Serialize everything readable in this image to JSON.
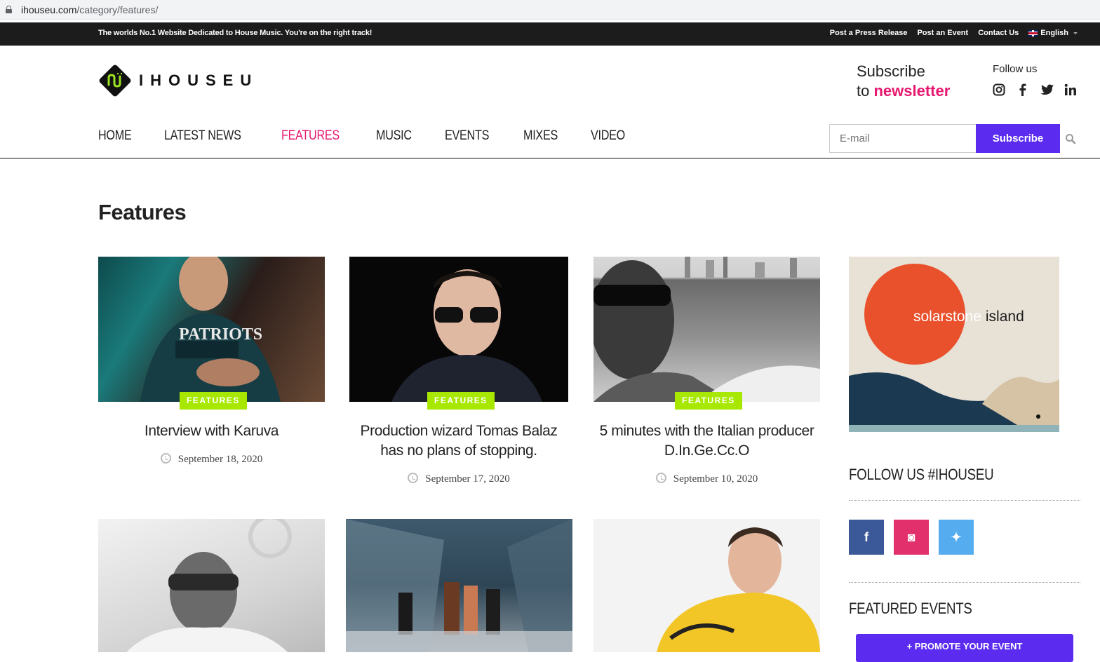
{
  "browser": {
    "url_domain": "ihouseu.com",
    "url_path": "/category/features/"
  },
  "topbar": {
    "tagline": "The worlds No.1 Website Dedicated to House Music. You're on the right track!",
    "links": [
      "Post a Press Release",
      "Post an Event",
      "Contact Us"
    ],
    "language": "English"
  },
  "header": {
    "logo_text": "IHOUSEU",
    "subscribe_line1": "Subscribe",
    "subscribe_line2_prefix": "to",
    "subscribe_line2_highlight": "newsletter",
    "follow_label": "Follow us",
    "social_icons": [
      "instagram-icon",
      "facebook-icon",
      "twitter-icon",
      "linkedin-icon"
    ]
  },
  "nav": {
    "items": [
      "HOME",
      "LATEST NEWS",
      "FEATURES",
      "MUSIC",
      "EVENTS",
      "MIXES",
      "VIDEO"
    ],
    "active": "FEATURES"
  },
  "newsletter": {
    "email_placeholder": "E-mail",
    "button_label": "Subscribe"
  },
  "page": {
    "title": "Features"
  },
  "articles": [
    {
      "category": "FEATURES",
      "title": "Interview with Karuva",
      "date": "September 18, 2020"
    },
    {
      "category": "FEATURES",
      "title": "Production wizard Tomas Balaz has no plans of stopping.",
      "date": "September 17, 2020"
    },
    {
      "category": "FEATURES",
      "title": "5 minutes with the Italian producer D.In.Ge.Cc.O",
      "date": "September 10, 2020"
    }
  ],
  "sidebar": {
    "ad_text_1": "solarstone",
    "ad_text_2": "island",
    "follow_heading": "FOLLOW US #IHOUSEU",
    "social_squares": [
      {
        "icon": "facebook-icon",
        "color": "#3b5998",
        "glyph": "f"
      },
      {
        "icon": "instagram-icon",
        "color": "#e1306c",
        "glyph": "◙"
      },
      {
        "icon": "twitter-icon",
        "color": "#55acee",
        "glyph": "✦"
      }
    ],
    "events_heading": "FEATURED EVENTS",
    "promote_label": "+ PROMOTE YOUR EVENT"
  },
  "colors": {
    "accent": "#e6186f",
    "button": "#5b2bf0",
    "badge": "#a8e800",
    "topbar": "#1c1c1c"
  }
}
